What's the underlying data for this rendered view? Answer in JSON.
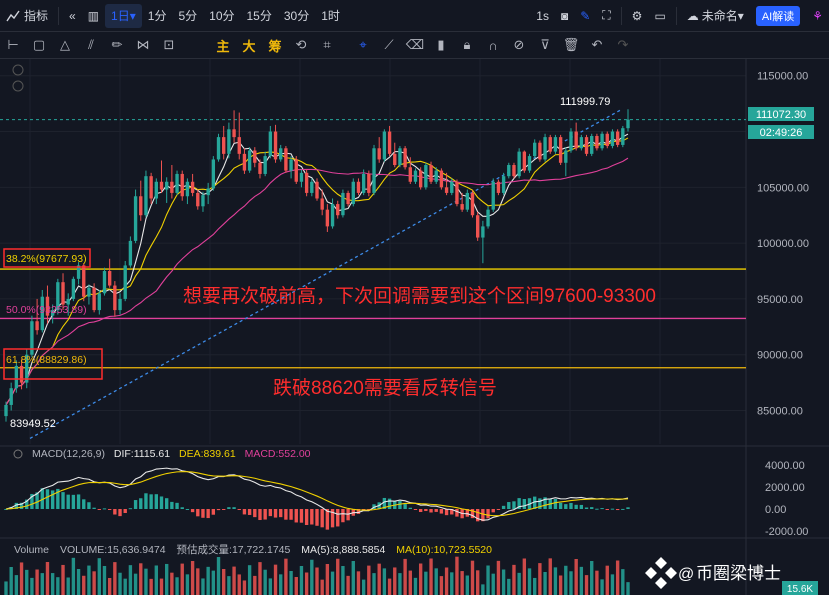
{
  "toolbar": {
    "indicator_label": "指标",
    "interval_active": "1日",
    "intervals": [
      "1分",
      "5分",
      "10分",
      "15分",
      "30分",
      "1时"
    ],
    "replay_label": "1s",
    "layout_name": "未命名",
    "ai_label": "AI解读"
  },
  "drawing": {
    "main_label": "主",
    "big_label": "大",
    "chip_label": "筹"
  },
  "colors": {
    "up": "#26a69a",
    "down": "#ef5350",
    "ma5": "#e8e8e8",
    "ma10": "#f0d000",
    "ma30": "#e0409a",
    "trend": "#3d8be8",
    "fib382": "#f0d000",
    "fib50": "#e0409a",
    "fib618": "#f0b90b",
    "annot": "#ff2d2d"
  },
  "price_axis": {
    "ticks": [
      "115000.00",
      "110000.00",
      "105000.00",
      "100000.00",
      "95000.00",
      "90000.00",
      "85000.00"
    ],
    "last_price": "111072.30",
    "countdown": "02:49:26",
    "high_label": "111999.79",
    "low_label": "83949.52"
  },
  "fib": {
    "l382": "38.2%(97677.93)",
    "l50": "50.0%(93253.89)",
    "l618": "61.8%(88829.86)"
  },
  "annotations": {
    "line1": "想要再次破前高，下次回调需要到这个区间97600-93300",
    "line2": "跌破88620需要看反转信号"
  },
  "macd": {
    "title": "MACD(12,26,9)",
    "dif": "DIF:1115.61",
    "dea": "DEA:839.61",
    "macd": "MACD:552.00",
    "ticks": [
      "4000.00",
      "2000.00",
      "0.00",
      "-2000.00"
    ]
  },
  "volume": {
    "title": "Volume",
    "volume": "VOLUME:15,636.9474",
    "est": "预估成交量:17,722.1745",
    "ma5": "MA(5):8,888.5854",
    "ma10": "MA(10):10,723.5520",
    "axis_label": "15.6K"
  },
  "watermark": "币圈梁博士",
  "chart_data": {
    "type": "candlestick",
    "ylim": [
      82000,
      116500
    ],
    "candles": [
      [
        84500,
        85800,
        84000,
        85500
      ],
      [
        85500,
        87500,
        85000,
        87000
      ],
      [
        87000,
        89500,
        86600,
        89000
      ],
      [
        89000,
        89600,
        86900,
        87500
      ],
      [
        87500,
        90500,
        87000,
        90000
      ],
      [
        90000,
        93500,
        89800,
        93000
      ],
      [
        93000,
        95000,
        91800,
        92200
      ],
      [
        92200,
        95800,
        92000,
        95200
      ],
      [
        95200,
        96200,
        92800,
        93500
      ],
      [
        93500,
        94500,
        92800,
        94000
      ],
      [
        94000,
        96800,
        93600,
        96500
      ],
      [
        96500,
        97300,
        94000,
        94500
      ],
      [
        94500,
        95500,
        93500,
        95000
      ],
      [
        95000,
        97000,
        94800,
        96800
      ],
      [
        96800,
        98300,
        96300,
        98000
      ],
      [
        98000,
        98200,
        94800,
        95200
      ],
      [
        95200,
        96300,
        94500,
        96000
      ],
      [
        96000,
        96400,
        93800,
        94000
      ],
      [
        94000,
        95800,
        93600,
        95500
      ],
      [
        95500,
        97800,
        95300,
        97500
      ],
      [
        97500,
        98600,
        96000,
        96200
      ],
      [
        96200,
        96600,
        93400,
        94000
      ],
      [
        94000,
        95500,
        93600,
        95000
      ],
      [
        95000,
        98400,
        94800,
        98000
      ],
      [
        98000,
        100600,
        97800,
        100200
      ],
      [
        100200,
        104800,
        100000,
        104200
      ],
      [
        104200,
        105600,
        102000,
        102500
      ],
      [
        102500,
        106500,
        102300,
        106000
      ],
      [
        106000,
        106300,
        103500,
        104000
      ],
      [
        104000,
        105800,
        103500,
        105500
      ],
      [
        105500,
        107400,
        104500,
        104800
      ],
      [
        104800,
        105900,
        103600,
        105500
      ],
      [
        105500,
        107000,
        104000,
        104500
      ],
      [
        104500,
        106500,
        104300,
        106200
      ],
      [
        106200,
        106500,
        103800,
        104200
      ],
      [
        104200,
        105800,
        103500,
        105500
      ],
      [
        105500,
        106200,
        104200,
        104500
      ],
      [
        104500,
        104800,
        103000,
        103300
      ],
      [
        103300,
        104600,
        102800,
        104300
      ],
      [
        104300,
        105400,
        103500,
        104900
      ],
      [
        104900,
        107800,
        104700,
        107500
      ],
      [
        107500,
        109800,
        107300,
        109500
      ],
      [
        109500,
        110500,
        107500,
        108000
      ],
      [
        108000,
        110800,
        107600,
        110200
      ],
      [
        110200,
        111900,
        109000,
        109500
      ],
      [
        109500,
        111700,
        107500,
        108000
      ],
      [
        108000,
        108500,
        106200,
        106500
      ],
      [
        106500,
        108600,
        106300,
        108300
      ],
      [
        108300,
        108600,
        106800,
        107200
      ],
      [
        107200,
        107500,
        105800,
        106200
      ],
      [
        106200,
        108200,
        106000,
        107800
      ],
      [
        107800,
        110500,
        107600,
        110000
      ],
      [
        110000,
        110600,
        107200,
        107500
      ],
      [
        107500,
        108800,
        107300,
        108500
      ],
      [
        108500,
        108700,
        106300,
        106500
      ],
      [
        106500,
        107800,
        105800,
        107500
      ],
      [
        107500,
        107800,
        105300,
        105500
      ],
      [
        105500,
        106600,
        105000,
        106300
      ],
      [
        106300,
        106600,
        104200,
        104500
      ],
      [
        104500,
        105800,
        104200,
        105500
      ],
      [
        105500,
        105800,
        103800,
        104000
      ],
      [
        104000,
        104800,
        102500,
        103000
      ],
      [
        103000,
        103500,
        101000,
        101500
      ],
      [
        101500,
        104000,
        101300,
        103500
      ],
      [
        103500,
        103800,
        102200,
        102500
      ],
      [
        102500,
        104800,
        102300,
        104500
      ],
      [
        104500,
        104700,
        103300,
        103500
      ],
      [
        103500,
        105800,
        103300,
        105500
      ],
      [
        105500,
        105800,
        104300,
        104500
      ],
      [
        104500,
        106600,
        104300,
        106200
      ],
      [
        106200,
        106500,
        104200,
        104500
      ],
      [
        104500,
        108800,
        104300,
        108500
      ],
      [
        108500,
        109500,
        107200,
        107500
      ],
      [
        107500,
        110200,
        107300,
        110000
      ],
      [
        110000,
        110500,
        107800,
        108000
      ],
      [
        108000,
        109000,
        106800,
        107000
      ],
      [
        107000,
        108700,
        106800,
        108500
      ],
      [
        108500,
        108700,
        106600,
        106800
      ],
      [
        106800,
        107700,
        105300,
        105500
      ],
      [
        105500,
        106700,
        105300,
        106500
      ],
      [
        106500,
        106800,
        104800,
        105000
      ],
      [
        105000,
        107200,
        104800,
        107000
      ],
      [
        107000,
        107300,
        105300,
        105500
      ],
      [
        105500,
        106800,
        105300,
        106500
      ],
      [
        106500,
        106700,
        104800,
        105000
      ],
      [
        105000,
        106300,
        104300,
        104500
      ],
      [
        104500,
        105800,
        104300,
        105500
      ],
      [
        105500,
        105700,
        103300,
        103500
      ],
      [
        103500,
        104500,
        102800,
        103000
      ],
      [
        103000,
        104800,
        102800,
        104500
      ],
      [
        104500,
        104700,
        102300,
        102500
      ],
      [
        102500,
        102800,
        100200,
        100500
      ],
      [
        100500,
        102000,
        98200,
        101500
      ],
      [
        101500,
        103300,
        101300,
        103000
      ],
      [
        103000,
        105800,
        102800,
        105500
      ],
      [
        105500,
        105700,
        104300,
        104500
      ],
      [
        104500,
        106300,
        104300,
        106000
      ],
      [
        106000,
        107200,
        105800,
        107000
      ],
      [
        107000,
        107200,
        105800,
        106000
      ],
      [
        106000,
        108500,
        105800,
        108200
      ],
      [
        108200,
        108300,
        106300,
        106500
      ],
      [
        106500,
        108000,
        106300,
        107800
      ],
      [
        107800,
        109300,
        107600,
        109000
      ],
      [
        109000,
        109200,
        107300,
        107500
      ],
      [
        107500,
        109800,
        107300,
        109500
      ],
      [
        109500,
        109700,
        108000,
        108200
      ],
      [
        108200,
        109700,
        108000,
        109500
      ],
      [
        109500,
        109700,
        107000,
        107200
      ],
      [
        107200,
        108600,
        106000,
        108300
      ],
      [
        108300,
        110300,
        108100,
        110000
      ],
      [
        110000,
        110800,
        108300,
        108500
      ],
      [
        108500,
        109700,
        108300,
        109500
      ],
      [
        109500,
        109700,
        107800,
        108000
      ],
      [
        108000,
        109800,
        107800,
        109600
      ],
      [
        109600,
        109800,
        108300,
        108500
      ],
      [
        108500,
        110000,
        108300,
        109800
      ],
      [
        109800,
        110000,
        108500,
        108700
      ],
      [
        108700,
        110200,
        108500,
        110000
      ],
      [
        110000,
        110200,
        108600,
        108800
      ],
      [
        108800,
        110500,
        108600,
        110300
      ],
      [
        110300,
        112000,
        110000,
        111072.3
      ]
    ],
    "fib_levels": [
      97677.93,
      93253.89,
      88829.86
    ],
    "high": 111999.79,
    "low": 83949.52
  }
}
